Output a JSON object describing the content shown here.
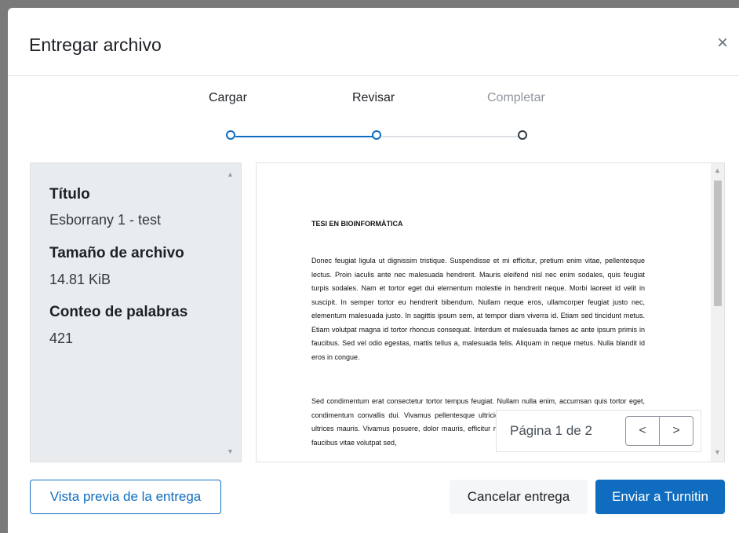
{
  "modal": {
    "title": "Entregar archivo",
    "close_glyph": "×"
  },
  "stepper": {
    "steps": [
      {
        "label": "Cargar",
        "state": "done"
      },
      {
        "label": "Revisar",
        "state": "current"
      },
      {
        "label": "Completar",
        "state": "pending"
      }
    ],
    "colors": {
      "active": "#0f6cbf",
      "inactive": "#8f959e",
      "line_inactive": "#dee2e6"
    }
  },
  "details": {
    "title_heading": "Título",
    "title_value": "Esborrany 1 - test",
    "size_heading": "Tamaño de archivo",
    "size_value": "14.81 KiB",
    "words_heading": "Conteo de palabras",
    "words_value": "421"
  },
  "preview": {
    "doc_title": "TESI EN BIOINFORMÀTICA",
    "paragraph_1": "Donec feugiat ligula ut dignissim tristique. Suspendisse et mi efficitur, pretium enim vitae, pellentesque lectus. Proin iaculis ante nec malesuada hendrerit. Mauris eleifend nisl nec enim sodales, quis feugiat turpis sodales. Nam et tortor eget dui elementum molestie in hendrerit neque. Morbi laoreet id velit in suscipit. In semper tortor eu hendrerit bibendum. Nullam neque eros, ullamcorper feugiat justo nec, elementum malesuada justo. In sagittis ipsum sem, at tempor diam viverra id. Etiam sed tincidunt metus. Etiam volutpat magna id tortor rhoncus consequat. Interdum et malesuada fames ac ante ipsum primis in faucibus. Sed vel odio egestas, mattis tellus a, malesuada felis. Aliquam in neque metus. Nulla blandit id eros in congue.",
    "paragraph_2": "Sed condimentum erat consectetur tortor tempus feugiat. Nullam nulla enim, accumsan quis tortor eget, condimentum convallis dui. Vivamus pellentesque ultricies eu, semper quis lacus. Vivamus interdum ultrices mauris. Vivamus posuere, dolor mauris, efficitur maximus nulla sapien nec ante. Sed elit tellus, faucibus vitae volutpat sed,",
    "pager_text": "Página 1 de 2",
    "prev_glyph": "<",
    "next_glyph": ">"
  },
  "footer": {
    "preview_button": "Vista previa de la entrega",
    "cancel_button": "Cancelar entrega",
    "submit_button": "Enviar a Turnitin"
  }
}
